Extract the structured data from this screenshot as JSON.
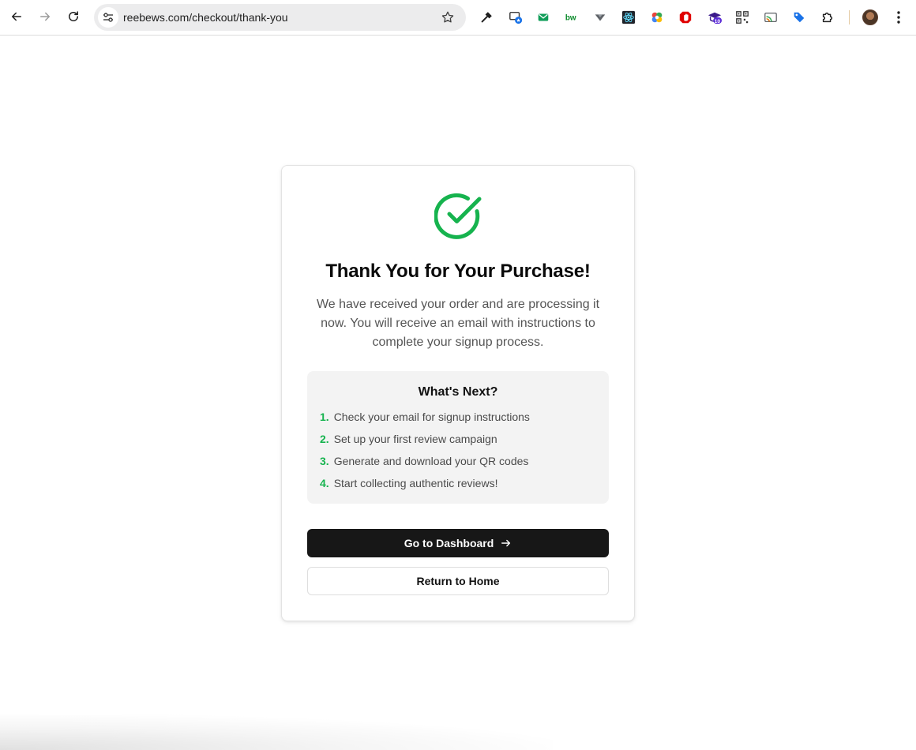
{
  "browser": {
    "url": "reebews.com/checkout/thank-you",
    "extensions": [
      {
        "name": "eyedropper-icon",
        "color": "#1f1f1f"
      },
      {
        "name": "tab-capture-icon",
        "color": "#1a73e8"
      },
      {
        "name": "mail-extension-icon",
        "color": "#0f9d58"
      },
      {
        "name": "bw-extension-icon",
        "color": "#0a8a2a"
      },
      {
        "name": "vue-devtools-icon",
        "color": "#5f6368"
      },
      {
        "name": "react-devtools-icon",
        "color": "#61dafb"
      },
      {
        "name": "color-wheel-icon",
        "color": "#e8453c"
      },
      {
        "name": "adblock-icon",
        "color": "#e00000"
      },
      {
        "name": "grad-cap-icon",
        "color": "#5b2bd6",
        "badge": "10"
      },
      {
        "name": "qr-code-icon",
        "color": "#333333"
      },
      {
        "name": "cast-icon",
        "color": "#e37400"
      },
      {
        "name": "tag-icon",
        "color": "#1a73e8"
      },
      {
        "name": "puzzle-icon",
        "color": "#1f1f1f"
      }
    ]
  },
  "confirmation": {
    "title": "Thank You for Your Purchase!",
    "message": "We have received your order and are processing it now. You will receive an email with instructions to complete your signup process.",
    "next_title": "What's Next?",
    "steps": [
      {
        "num": "1.",
        "text": "Check your email for signup instructions"
      },
      {
        "num": "2.",
        "text": "Set up your first review campaign"
      },
      {
        "num": "3.",
        "text": "Generate and download your QR codes"
      },
      {
        "num": "4.",
        "text": "Start collecting authentic reviews!"
      }
    ],
    "primary_button": "Go to Dashboard",
    "secondary_button": "Return to Home"
  },
  "colors": {
    "success": "#16b34e",
    "primary_button": "#171717",
    "panel_background": "#f3f3f3"
  }
}
